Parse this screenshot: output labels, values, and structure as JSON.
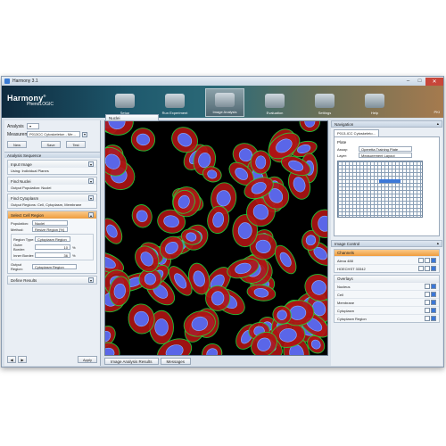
{
  "window": {
    "title": "Harmony 3.1"
  },
  "brand": {
    "name": "Harmony",
    "product": "PhenoLOGIC"
  },
  "nav": [
    {
      "label": "Setup",
      "icon": "setup-icon"
    },
    {
      "label": "Run Experiment",
      "icon": "run-experiment-icon"
    },
    {
      "label": "Image Analysis",
      "icon": "image-analysis-icon",
      "active": true
    },
    {
      "label": "Evaluation",
      "icon": "evaluation-icon"
    },
    {
      "label": "Settings",
      "icon": "settings-icon"
    },
    {
      "label": "Help",
      "icon": "help-icon"
    }
  ],
  "user": "PKI",
  "left": {
    "analysis_label": "Analysis",
    "measurement_label": "Measurement",
    "measurement_value": "P013CC Cytoskeleton - Me...",
    "buttons": {
      "new": "New",
      "save": "Save",
      "test": "Test"
    },
    "sequence_title": "Analysis Sequence",
    "blocks": {
      "input_image": {
        "title": "Input Image",
        "body": "Using:  Individual Planes"
      },
      "find_nuclei": {
        "title": "Find Nuclei",
        "output_label": "Output Population:",
        "output_value": "Nuclei"
      },
      "find_cytoplasm": {
        "title": "Find Cytoplasm",
        "output_label": "Output Regions:",
        "output_value": "Cell, Cytoplasm, Membrane"
      },
      "select_cell_region": {
        "title": "Select Cell Region",
        "population_label": "Population:",
        "population_value": "Nuclei",
        "method_label": "Method:",
        "method_value": "Resize Region [%]",
        "region_type_label": "Region Type:",
        "region_type_value": "Cytoplasm Region",
        "outer_border_label": "Outer Border:",
        "outer_border_value": "10",
        "inner_border_label": "Inner Border:",
        "inner_border_value": "36",
        "unit": "%",
        "output_label": "Output Region:",
        "output_value": "Cytoplasm Region"
      },
      "define_results": {
        "title": "Define Results"
      }
    },
    "apply": "Apply"
  },
  "center": {
    "tab": "Nuclei",
    "bottom_tabs": [
      "Image Analysis Results",
      "Messages"
    ]
  },
  "navigation": {
    "title": "Navigation",
    "tab": "P013-ICC Cytoskeleto...",
    "plate_label": "Plate",
    "assay_label": "Assay:",
    "assay_value": "Operetta Training Plate",
    "layer_label": "Layer:",
    "layer_value": "Measurement Layout"
  },
  "image_control": {
    "title": "Image Control",
    "channels_title": "Channels",
    "channels": [
      "Alexa 488",
      "HOECHST 33342"
    ],
    "overlays_title": "Overlays",
    "overlays": [
      "Nucleus",
      "Cell",
      "Membrane",
      "Cytoplasm",
      "Cytoplasm Region"
    ]
  }
}
